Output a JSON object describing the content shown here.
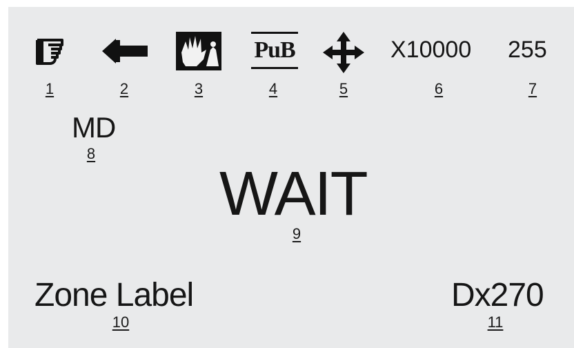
{
  "status_bar": {
    "icons": [
      {
        "icon": "hand-pointer-icon",
        "number": "1"
      },
      {
        "icon": "arrow-left-icon",
        "number": "2"
      },
      {
        "icon": "hand-pan-icon",
        "number": "3"
      },
      {
        "icon": "pub-icon",
        "number": "4",
        "text": "PuB"
      },
      {
        "icon": "move-arrows-icon",
        "number": "5"
      }
    ],
    "zoom": {
      "value": "X10000",
      "number": "6"
    },
    "count": {
      "value": "255",
      "number": "7"
    }
  },
  "mode": {
    "value": "MD",
    "number": "8"
  },
  "message": {
    "value": "WAIT",
    "number": "9"
  },
  "zone_label": {
    "value": "Zone Label",
    "number": "10"
  },
  "position": {
    "value": "Dx270",
    "number": "11"
  }
}
